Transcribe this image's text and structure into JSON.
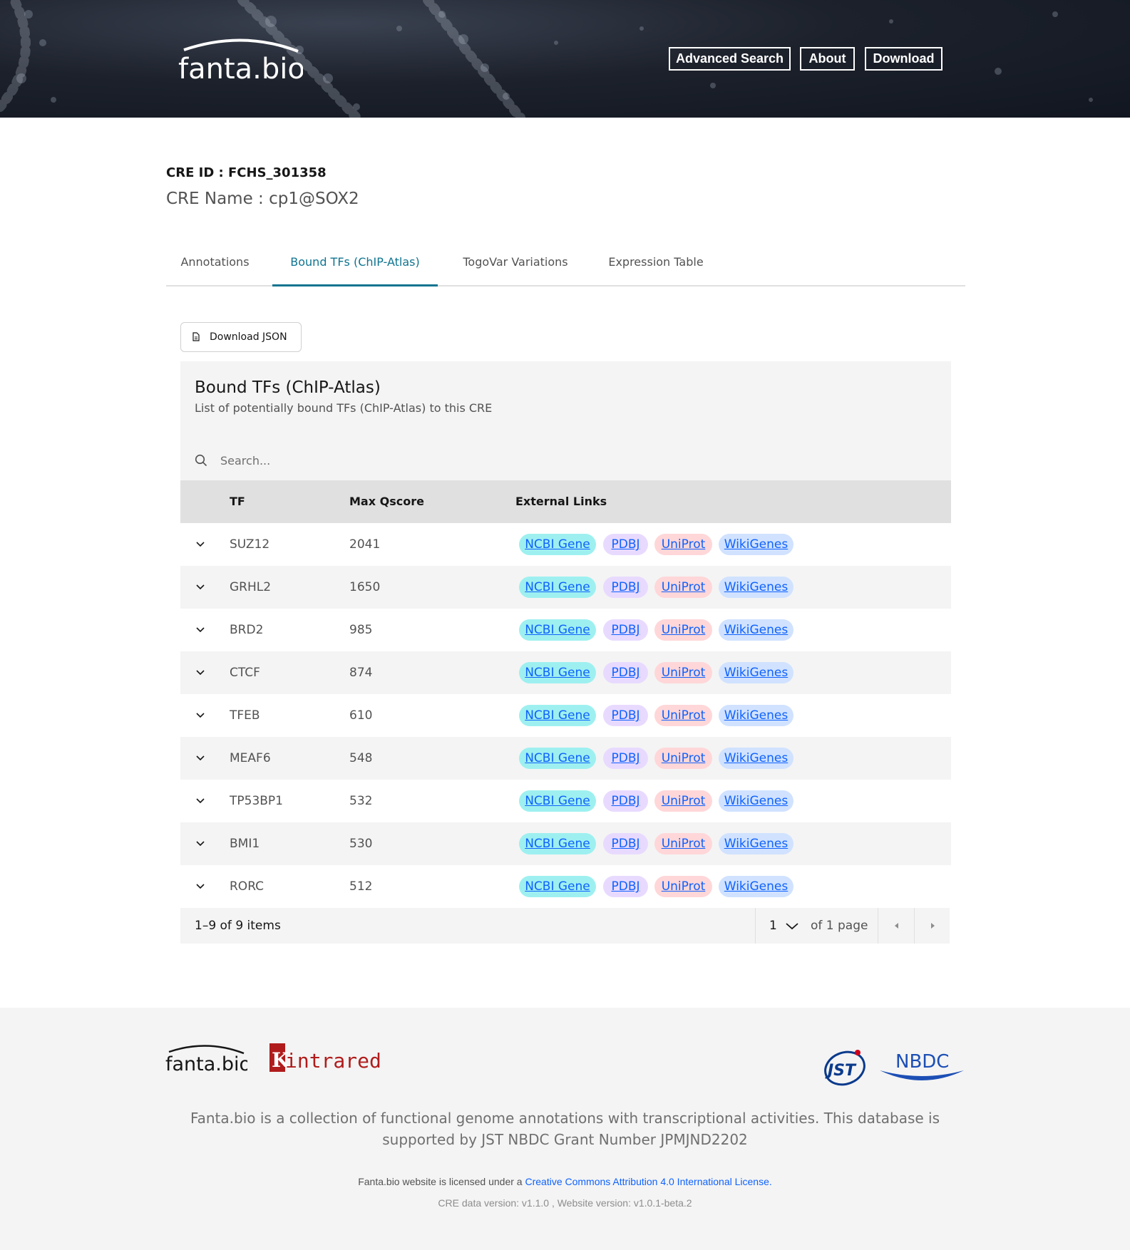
{
  "header": {
    "logo_text": "fanta.bio",
    "nav": [
      "Advanced Search",
      "About",
      "Download"
    ]
  },
  "cre": {
    "id_label": "CRE ID : FCHS_301358",
    "name_label": "CRE Name : cp1@SOX2"
  },
  "tabs": [
    {
      "label": "Annotations",
      "active": false
    },
    {
      "label": "Bound TFs (ChIP-Atlas)",
      "active": true
    },
    {
      "label": "TogoVar Variations",
      "active": false
    },
    {
      "label": "Expression Table",
      "active": false
    }
  ],
  "download_json_label": "Download JSON",
  "table": {
    "title": "Bound TFs (ChIP-Atlas)",
    "subtitle": "List of potentially bound TFs (ChIP-Atlas) to this CRE",
    "search_placeholder": "Search...",
    "columns": [
      "TF",
      "Max Qscore",
      "External Links"
    ],
    "links": [
      "NCBI Gene",
      "PDBJ",
      "UniProt",
      "WikiGenes"
    ],
    "rows": [
      {
        "tf": "SUZ12",
        "q": "2041"
      },
      {
        "tf": "GRHL2",
        "q": "1650"
      },
      {
        "tf": "BRD2",
        "q": "985"
      },
      {
        "tf": "CTCF",
        "q": "874"
      },
      {
        "tf": "TFEB",
        "q": "610"
      },
      {
        "tf": "MEAF6",
        "q": "548"
      },
      {
        "tf": "TP53BP1",
        "q": "532"
      },
      {
        "tf": "BMI1",
        "q": "530"
      },
      {
        "tf": "RORC",
        "q": "512"
      }
    ],
    "pagination": {
      "items": "1–9 of 9 items",
      "page": "1",
      "of_pages": "of 1 page"
    }
  },
  "footer": {
    "logo_text": "fanta.bio",
    "intrared_text": "intrared",
    "intrared_initial": "K",
    "jst_text": "JST",
    "nbdc_text": "NBDC",
    "description": "Fanta.bio is a collection of functional genome annotations with transcriptional activities. This database is supported by JST NBDC Grant Number JPMJND2202",
    "license_prefix": "Fanta.bio website is licensed under a ",
    "license_link": "Creative Commons Attribution 4.0 International License.",
    "version": "CRE data version: v1.1.0 , Website version: v1.0.1-beta.2"
  },
  "colors": {
    "accent": "#0f7490",
    "ncbi_tag": "#9ef0f0",
    "pdbj_tag": "#e8daff",
    "uniprot_tag": "#ffd7d9",
    "wikigenes_tag": "#d0e2ff",
    "link": "#0f62fe"
  }
}
